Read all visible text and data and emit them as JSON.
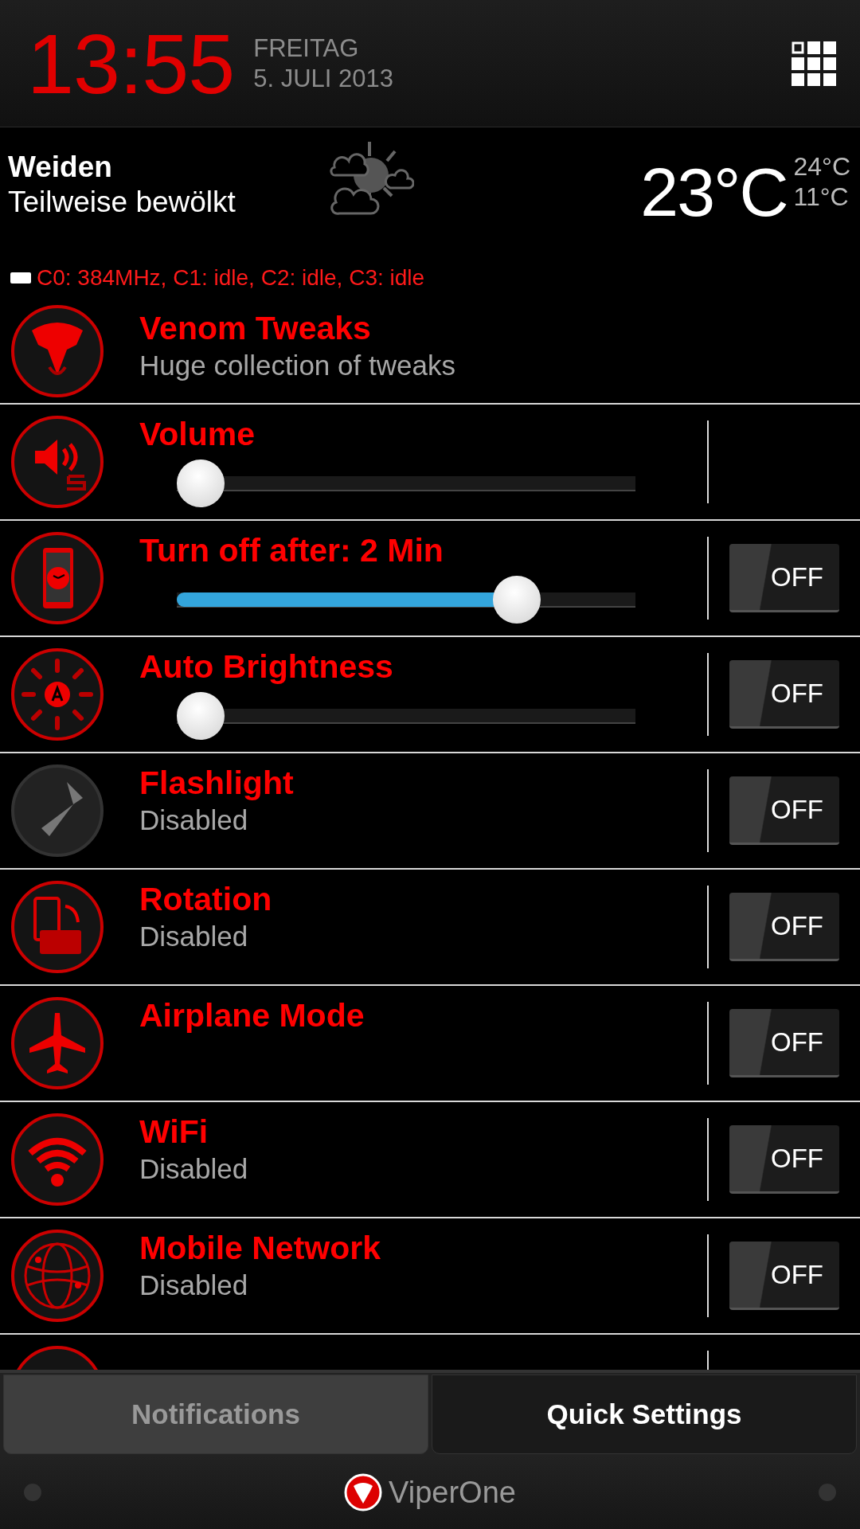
{
  "header": {
    "time": "13:55",
    "weekday": "FREITAG",
    "date": "5. JULI 2013"
  },
  "weather": {
    "city": "Weiden",
    "condition": "Teilweise bewölkt",
    "temperature": "23°C",
    "high": "24°C",
    "low": "11°C"
  },
  "cpu_status": "C0: 384MHz, C1: idle, C2: idle, C3: idle",
  "settings": [
    {
      "kind": "header",
      "title": "Venom Tweaks",
      "subtitle": "Huge collection of tweaks"
    },
    {
      "kind": "slider",
      "title": "Volume",
      "level": 0
    },
    {
      "kind": "slider-toggle",
      "title": "Turn off after: 2 Min",
      "level": 0.77,
      "toggle": "OFF",
      "on": false
    },
    {
      "kind": "slider-toggle",
      "title": "Auto Brightness",
      "level": 0,
      "toggle": "OFF",
      "on": false
    },
    {
      "kind": "toggle",
      "title": "Flashlight",
      "subtitle": "Disabled",
      "toggle": "OFF",
      "on": false
    },
    {
      "kind": "toggle",
      "title": "Rotation",
      "subtitle": "Disabled",
      "toggle": "OFF",
      "on": false
    },
    {
      "kind": "toggle",
      "title": "Airplane Mode",
      "toggle": "OFF",
      "on": false
    },
    {
      "kind": "toggle",
      "title": "WiFi",
      "subtitle": "Disabled",
      "toggle": "OFF",
      "on": false
    },
    {
      "kind": "toggle",
      "title": "Mobile Network",
      "subtitle": "Disabled",
      "toggle": "OFF",
      "on": false
    },
    {
      "kind": "toggle"
    }
  ],
  "tabs": [
    {
      "label": "Notifications",
      "selected": false
    },
    {
      "label": "Quick Settings",
      "selected": true
    }
  ],
  "footer": {
    "brand": "ViperOne"
  }
}
